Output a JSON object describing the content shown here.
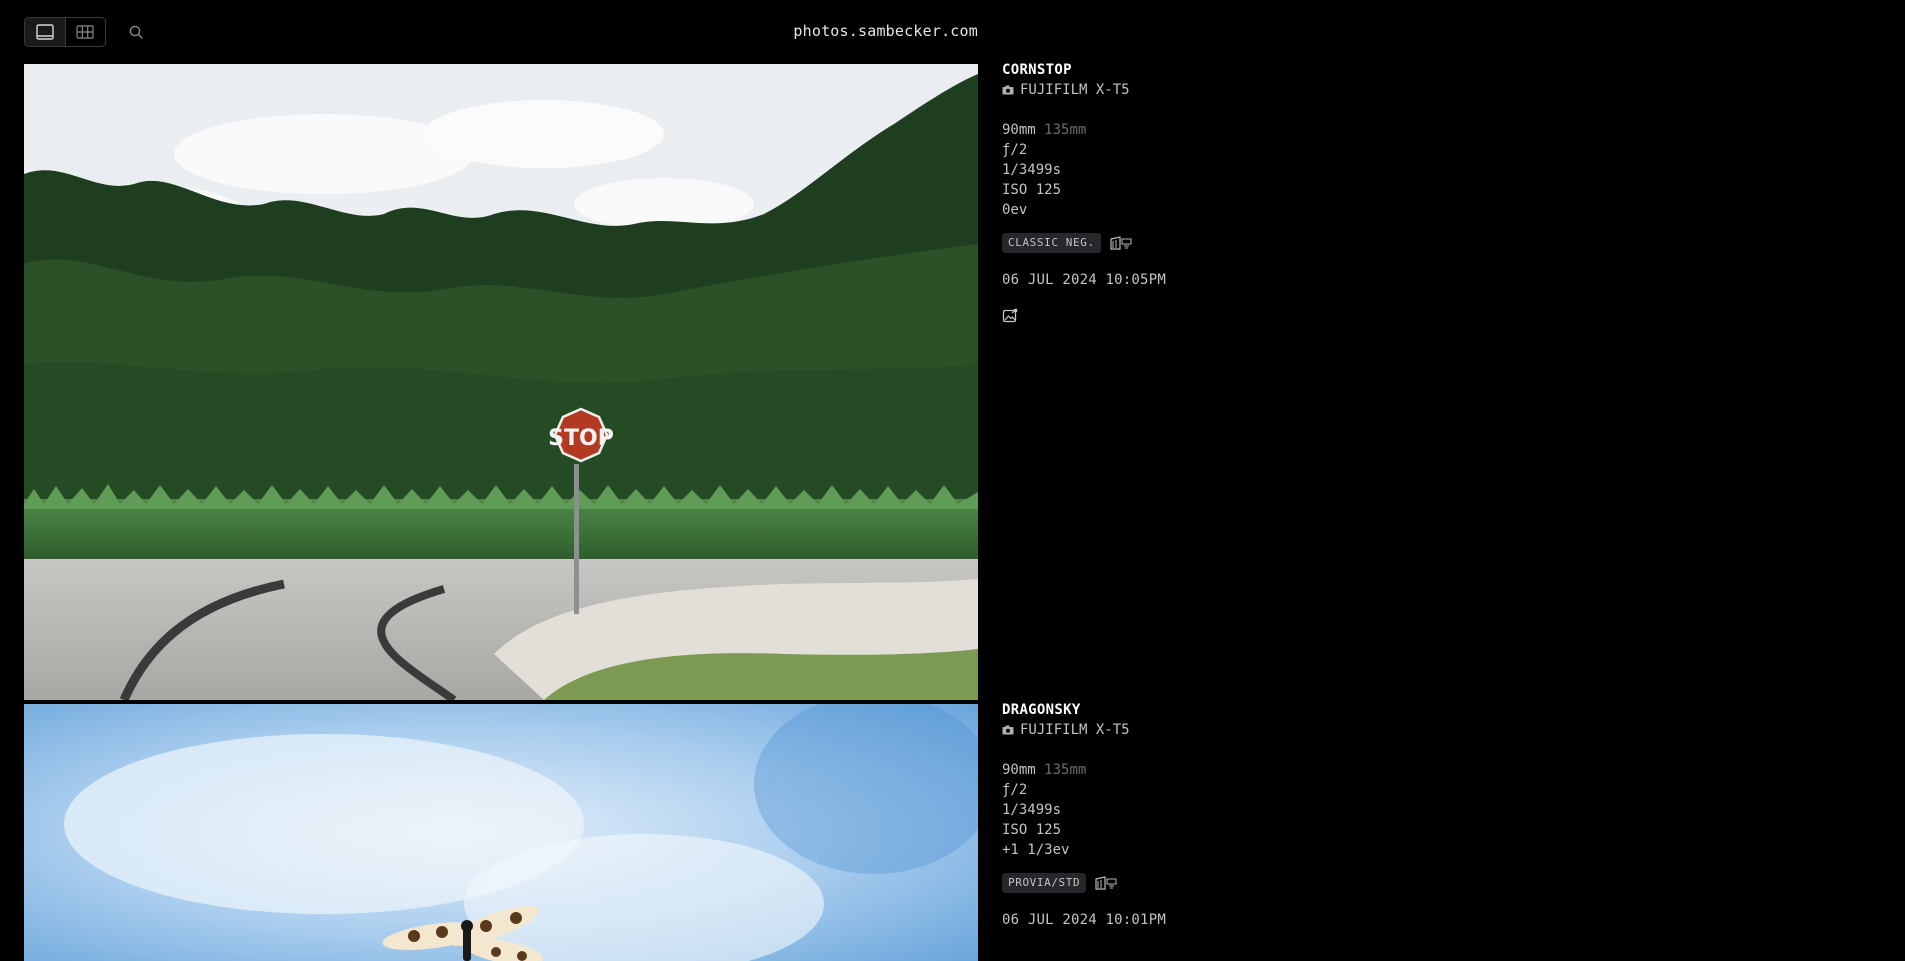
{
  "header": {
    "site_title": "photos.sambecker.com",
    "view_full_icon": "full-frame-view-icon",
    "view_grid_icon": "grid-view-icon",
    "search_icon": "search-icon"
  },
  "photos": [
    {
      "title": "CORNSTOP",
      "camera": "FUJIFILM X-T5",
      "focal_length": "90mm",
      "focal_length_35mm": "135mm",
      "aperture": "ƒ/2",
      "shutter": "1/3499s",
      "iso": "ISO 125",
      "exposure_comp": "0ev",
      "film_simulation": "CLASSIC NEG.",
      "date": "06 JUL 2024 10:05PM"
    },
    {
      "title": "DRAGONSKY",
      "camera": "FUJIFILM X-T5",
      "focal_length": "90mm",
      "focal_length_35mm": "135mm",
      "aperture": "ƒ/2",
      "shutter": "1/3499s",
      "iso": "ISO 125",
      "exposure_comp": "+1 1/3ev",
      "film_simulation": "PROVIA/STD",
      "date": "06 JUL 2024 10:01PM"
    }
  ],
  "colors": {
    "background": "#000000",
    "badge_bg": "#26262b",
    "text": "#c4c4c4",
    "dim_text": "#6b6b6b"
  }
}
